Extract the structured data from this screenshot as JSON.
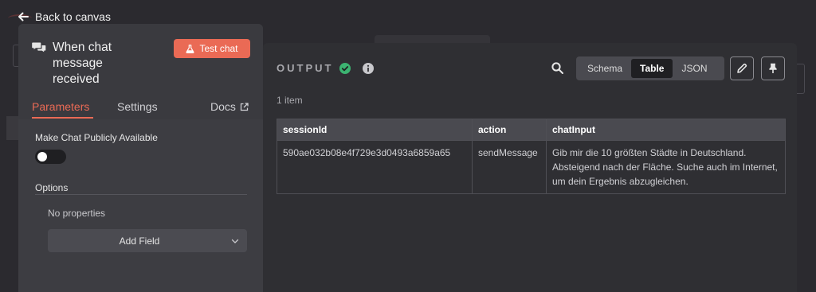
{
  "nav": {
    "back_label": "Back to canvas"
  },
  "node": {
    "title": "When chat message received",
    "test_button": "Test chat",
    "tabs": [
      {
        "label": "Parameters",
        "active": true
      },
      {
        "label": "Settings",
        "active": false
      },
      {
        "label": "Docs",
        "active": false
      }
    ],
    "params": {
      "public_label": "Make Chat Publicly Available",
      "public_enabled": false,
      "options_label": "Options",
      "no_properties": "No properties",
      "add_field": "Add Field"
    }
  },
  "output": {
    "title": "OUTPUT",
    "status": "success",
    "views": [
      "Schema",
      "Table",
      "JSON"
    ],
    "active_view": "Table",
    "item_count": "1 item",
    "table": {
      "columns": [
        "sessionId",
        "action",
        "chatInput"
      ],
      "rows": [
        [
          "590ae032b08e4f729e3d0493a6859a65",
          "sendMessage",
          "Gib mir die 10 größten Städte in Deutschland. Absteigend nach der Fläche. Suche auch im Internet, um dein Ergebnis abzugleichen."
        ]
      ]
    }
  },
  "colors": {
    "accent": "#ea6a55",
    "success": "#3cb371",
    "panel_bg": "#2f2f33",
    "node_bg": "#3d3d42"
  }
}
